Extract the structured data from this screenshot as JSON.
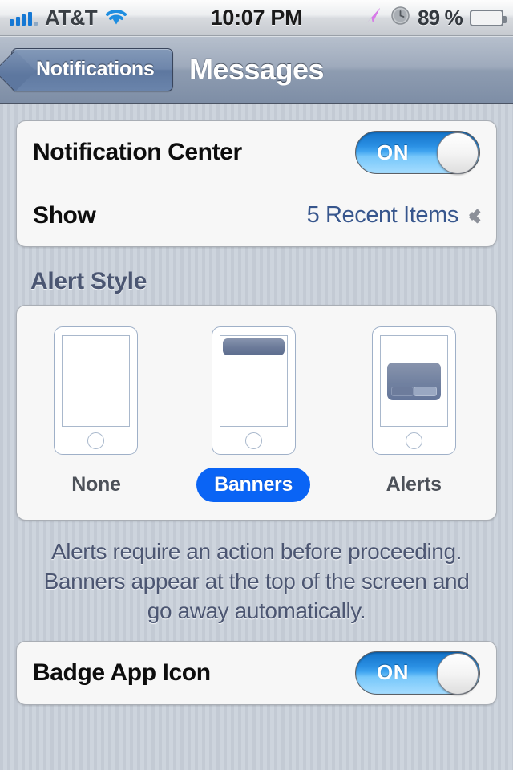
{
  "status_bar": {
    "carrier": "AT&T",
    "signal_bars": 5,
    "wifi_icon": "wifi-icon",
    "time": "10:07 PM",
    "location_icon": "location-arrow-icon",
    "alarm_icon": "alarm-clock-icon",
    "battery_percent": "89 %",
    "battery_level": 88,
    "battery_color": "#64c41c"
  },
  "nav_bar": {
    "back_label": "Notifications",
    "title": "Messages"
  },
  "settings_group": {
    "rows": [
      {
        "label": "Notification Center",
        "control": "toggle",
        "toggle_label": "ON",
        "toggle_on": true
      },
      {
        "label": "Show",
        "control": "disclosure",
        "value": "5 Recent Items",
        "chevron_icon": "chevron-right-icon"
      }
    ]
  },
  "alert_style": {
    "header": "Alert Style",
    "options": [
      {
        "label": "None",
        "selected": false,
        "illustration": "phone-blank-icon"
      },
      {
        "label": "Banners",
        "selected": true,
        "illustration": "phone-banner-icon"
      },
      {
        "label": "Alerts",
        "selected": false,
        "illustration": "phone-alert-icon"
      }
    ],
    "selected_color": "#0a64f5",
    "footer_lines": [
      "Alerts require an action before proceeding.",
      "Banners appear at the top of the screen and",
      "go away automatically."
    ]
  },
  "badge_group": {
    "rows": [
      {
        "label": "Badge App Icon",
        "control": "toggle",
        "toggle_label": "ON",
        "toggle_on": true
      }
    ]
  }
}
